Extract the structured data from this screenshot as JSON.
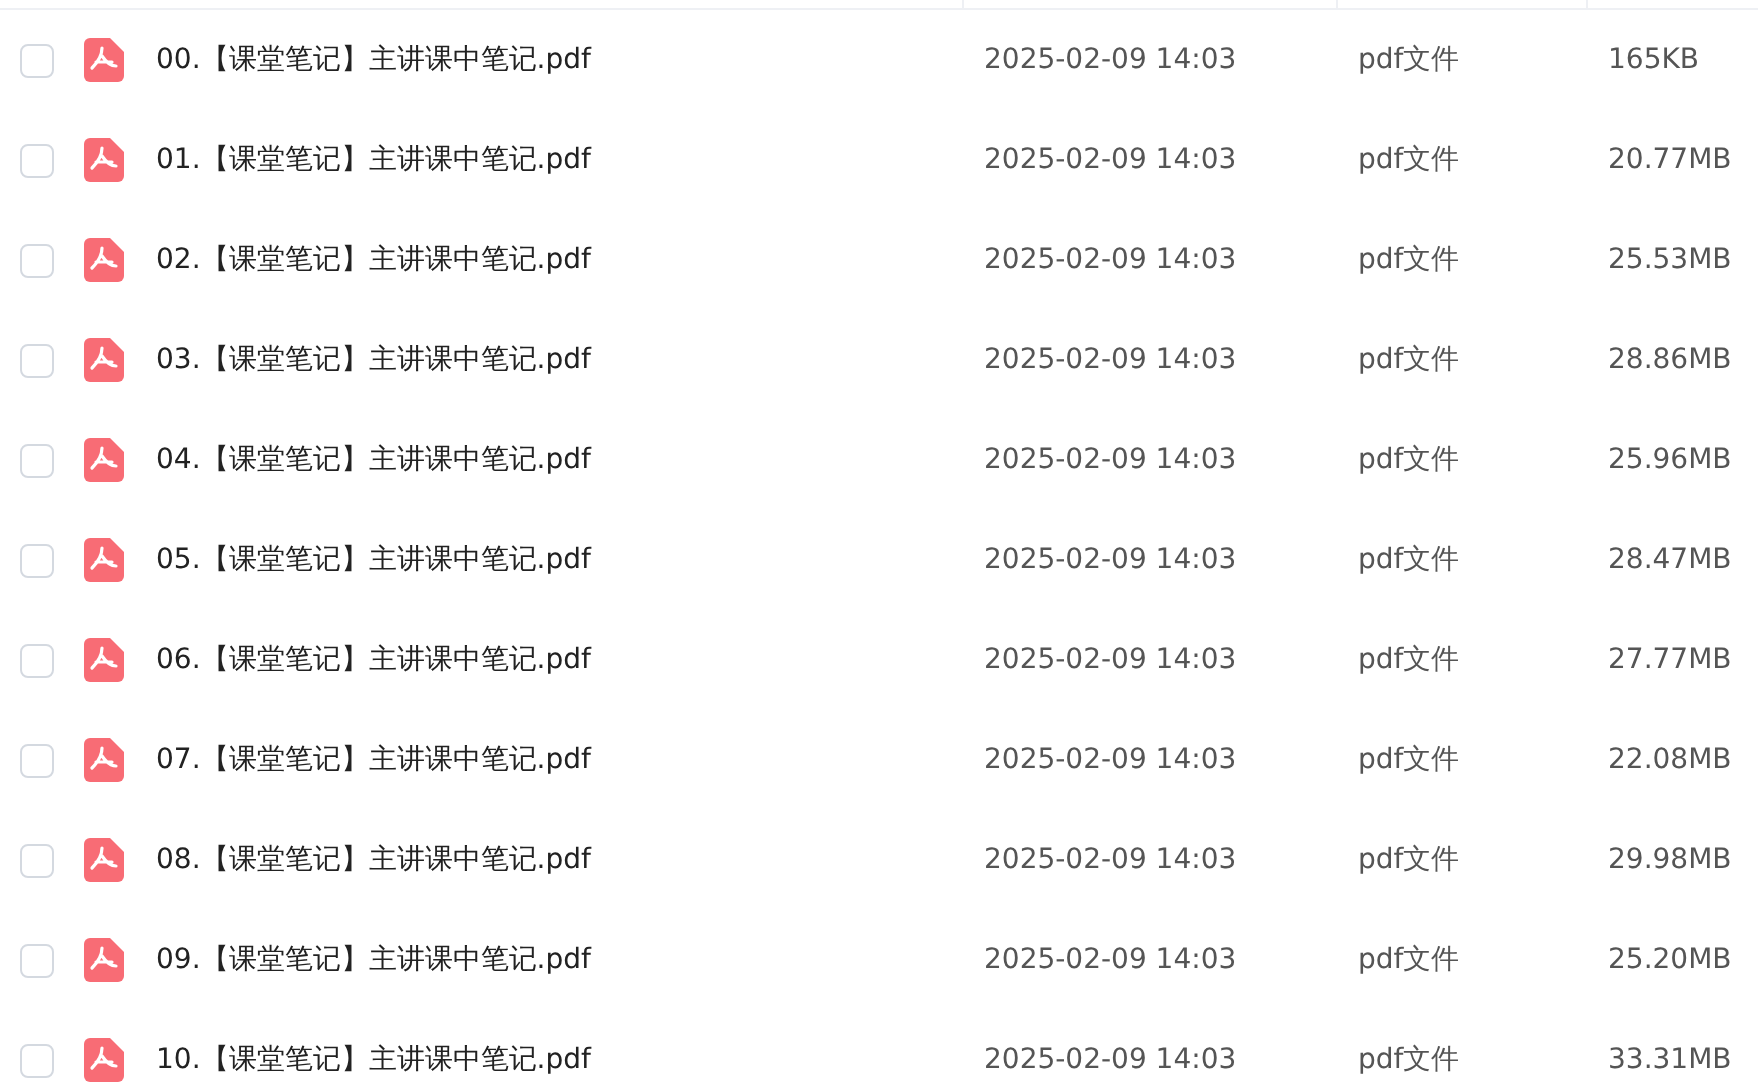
{
  "files": [
    {
      "name": "00.【课堂笔记】主讲课中笔记.pdf",
      "modified": "2025-02-09 14:03",
      "type": "pdf文件",
      "size": "165KB",
      "checked": false
    },
    {
      "name": "01.【课堂笔记】主讲课中笔记.pdf",
      "modified": "2025-02-09 14:03",
      "type": "pdf文件",
      "size": "20.77MB",
      "checked": false
    },
    {
      "name": "02.【课堂笔记】主讲课中笔记.pdf",
      "modified": "2025-02-09 14:03",
      "type": "pdf文件",
      "size": "25.53MB",
      "checked": false
    },
    {
      "name": "03.【课堂笔记】主讲课中笔记.pdf",
      "modified": "2025-02-09 14:03",
      "type": "pdf文件",
      "size": "28.86MB",
      "checked": false
    },
    {
      "name": "04.【课堂笔记】主讲课中笔记.pdf",
      "modified": "2025-02-09 14:03",
      "type": "pdf文件",
      "size": "25.96MB",
      "checked": false
    },
    {
      "name": "05.【课堂笔记】主讲课中笔记.pdf",
      "modified": "2025-02-09 14:03",
      "type": "pdf文件",
      "size": "28.47MB",
      "checked": false
    },
    {
      "name": "06.【课堂笔记】主讲课中笔记.pdf",
      "modified": "2025-02-09 14:03",
      "type": "pdf文件",
      "size": "27.77MB",
      "checked": false
    },
    {
      "name": "07.【课堂笔记】主讲课中笔记.pdf",
      "modified": "2025-02-09 14:03",
      "type": "pdf文件",
      "size": "22.08MB",
      "checked": false
    },
    {
      "name": "08.【课堂笔记】主讲课中笔记.pdf",
      "modified": "2025-02-09 14:03",
      "type": "pdf文件",
      "size": "29.98MB",
      "checked": false
    },
    {
      "name": "09.【课堂笔记】主讲课中笔记.pdf",
      "modified": "2025-02-09 14:03",
      "type": "pdf文件",
      "size": "25.20MB",
      "checked": false
    },
    {
      "name": "10.【课堂笔记】主讲课中笔记.pdf",
      "modified": "2025-02-09 14:03",
      "type": "pdf文件",
      "size": "33.31MB",
      "checked": false
    }
  ]
}
